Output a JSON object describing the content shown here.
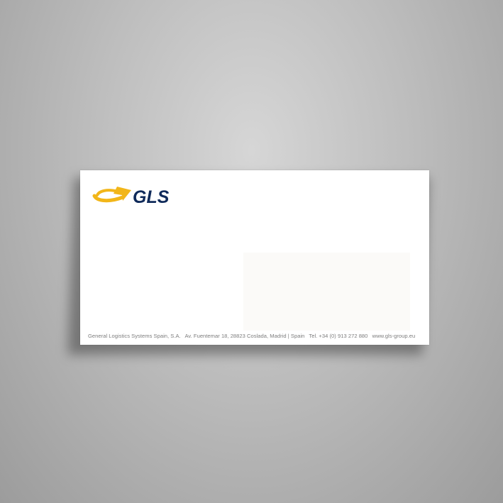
{
  "background": {
    "color_light": "#d6d6d6",
    "color_dark": "#9c9c9c"
  },
  "envelope": {
    "paper_color": "#ffffff",
    "logo": {
      "text": "GLS",
      "arrow_color": "#f2b619",
      "text_color": "#0f2a5a"
    },
    "footer": {
      "company": "General Logistics Systems Spain, S.A.",
      "address": "Av. Fuentemar 18, 28823 Coslada, Madrid | Spain",
      "phone": "Tel. +34 (0) 913 272 880",
      "website": "www.gls-group.eu"
    }
  }
}
